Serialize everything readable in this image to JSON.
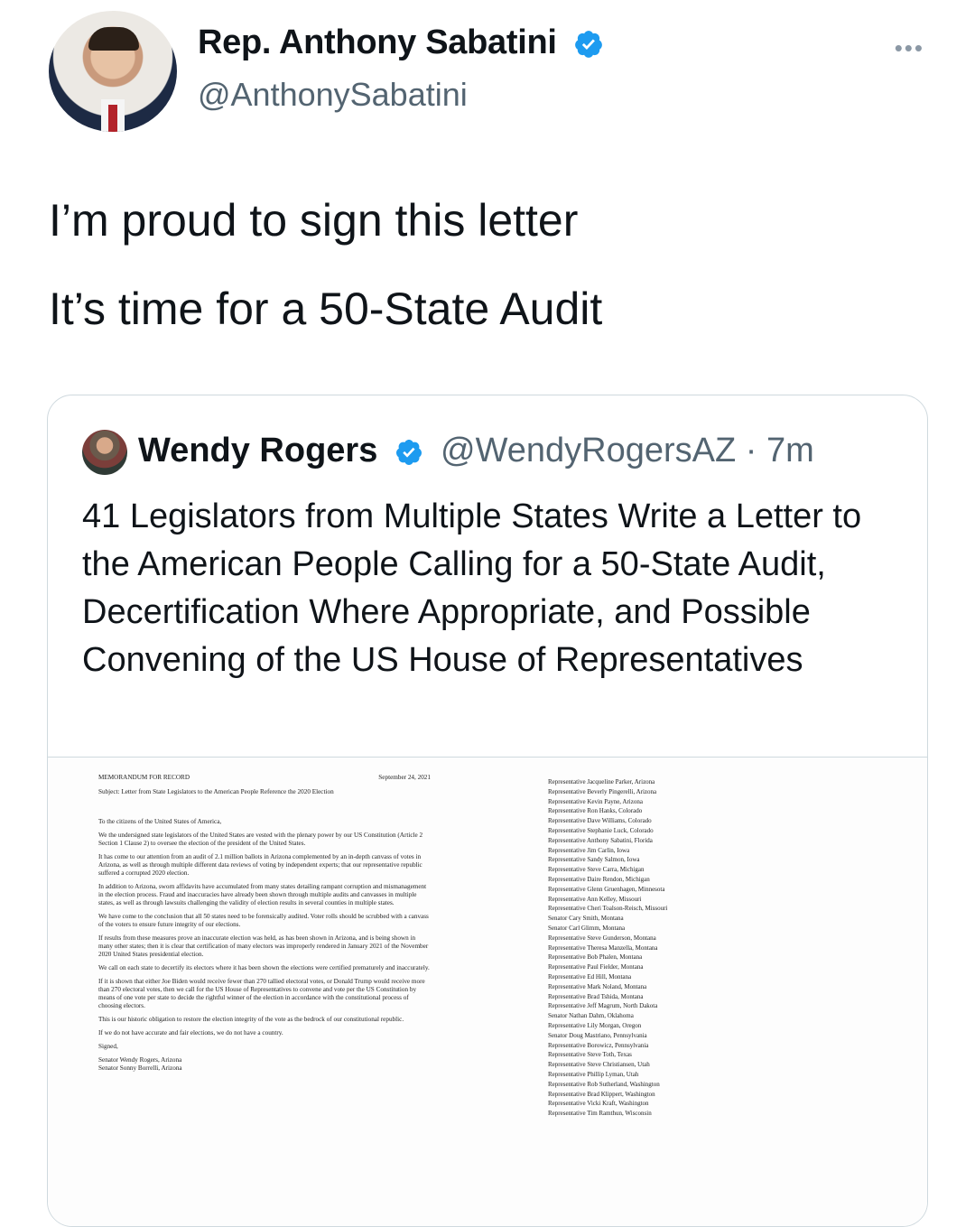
{
  "author": {
    "name": "Rep. Anthony Sabatini",
    "handle": "@AnthonySabatini",
    "verified": true
  },
  "more_icon": "more-dots-icon",
  "tweet": {
    "line1": "I’m proud to sign this letter",
    "line2": "It’s time for a 50-State Audit"
  },
  "quote": {
    "name": "Wendy Rogers",
    "handle_time": "@WendyRogersAZ · 7m",
    "text": "41 Legislators from Multiple States Write a Letter to the American People Calling for a 50-State Audit, Decertification Where Appropriate, and Possible Convening of the US House of Representatives"
  },
  "document": {
    "memo_label": "MEMORANDUM FOR RECORD",
    "date": "September 24, 2021",
    "subject": "Subject: Letter from State Legislators to the American People Reference the 2020 Election",
    "paragraphs": [
      "To the citizens of the United States of America,",
      "We the undersigned state legislators of the United States are vested with the plenary power by our US Constitution (Article 2 Section 1 Clause 2) to oversee the election of the president of the United States.",
      "It has come to our attention from an audit of 2.1 million ballots in Arizona complemented by an in-depth canvass of votes in Arizona, as well as through multiple different data reviews of voting by independent experts; that our representative republic suffered a corrupted 2020 election.",
      "In addition to Arizona, sworn affidavits have accumulated from many states detailing rampant corruption and mismanagement in the election process. Fraud and inaccuracies have already been shown through multiple audits and canvasses in multiple states, as well as through lawsuits challenging the validity of election results in several counties in multiple states.",
      "We have come to the conclusion that all 50 states need to be forensically audited. Voter rolls should be scrubbed with a canvass of the voters to ensure future integrity of our elections.",
      "If results from these measures prove an inaccurate election was held, as has been shown in Arizona, and is being shown in many other states; then it is clear that certification of many electors was improperly rendered in January 2021 of the November 2020 United States presidential election.",
      "We call on each state to decertify its electors where it has been shown the elections were certified prematurely and inaccurately.",
      "If it is shown that either Joe Biden would receive fewer than 270 tallied electoral votes, or Donald Trump would receive more than 270 electoral votes, then we call for the US House of Representatives to convene and vote per the US Constitution by means of one vote per state to decide the rightful winner of the election in accordance with the constitutional process of choosing electors.",
      "This is our historic obligation to restore the election integrity of the vote as the bedrock of our constitutional republic.",
      "If we do not have accurate and fair elections, we do not have a country.",
      "Signed,"
    ],
    "signers_left": [
      "Senator Wendy Rogers, Arizona",
      "Senator Sonny Borrelli, Arizona"
    ],
    "signers_right": [
      "Representative Jacqueline Parker, Arizona",
      "Representative Beverly Pingerelli, Arizona",
      "Representative Kevin Payne, Arizona",
      "Representative Ron Hanks, Colorado",
      "Representative Dave Williams, Colorado",
      "Representative Stephanie Luck, Colorado",
      "Representative Anthony Sabatini, Florida",
      "Representative Jim Carlin, Iowa",
      "Representative Sandy Salmon, Iowa",
      "Representative Steve Carra, Michigan",
      "Representative Daire Rendon, Michigan",
      "Representative Glenn Gruenhagen, Minnesota",
      "Representative Ann Kelley, Missouri",
      "Representative Cheri Toalson-Reisch, Missouri",
      "Senator Cary Smith, Montana",
      "Senator Carl Glimm, Montana",
      "Representative Steve Gunderson, Montana",
      "Representative Theresa Manzella, Montana",
      "Representative Bob Phalen, Montana",
      "Representative Paul Fielder, Montana",
      "Representative Ed Hill, Montana",
      "Representative Mark Noland, Montana",
      "Representative Brad Tshida, Montana",
      "Representative Jeff Magrum, North Dakota",
      "Senator Nathan Dahm, Oklahoma",
      "Representative Lily Morgan, Oregon",
      "Senator Doug Mastriano, Pennsylvania",
      "Representative Borowicz, Pennsylvania",
      "Representative Steve Toth, Texas",
      "Representative Steve Christiansen, Utah",
      "Representative Phillip Lyman, Utah",
      "Representative Rob Sutherland, Washington",
      "Representative Brad Klippert, Washington",
      "Representative Vicki Kraft, Washington",
      "Representative Tim Ramthun, Wisconsin"
    ]
  }
}
